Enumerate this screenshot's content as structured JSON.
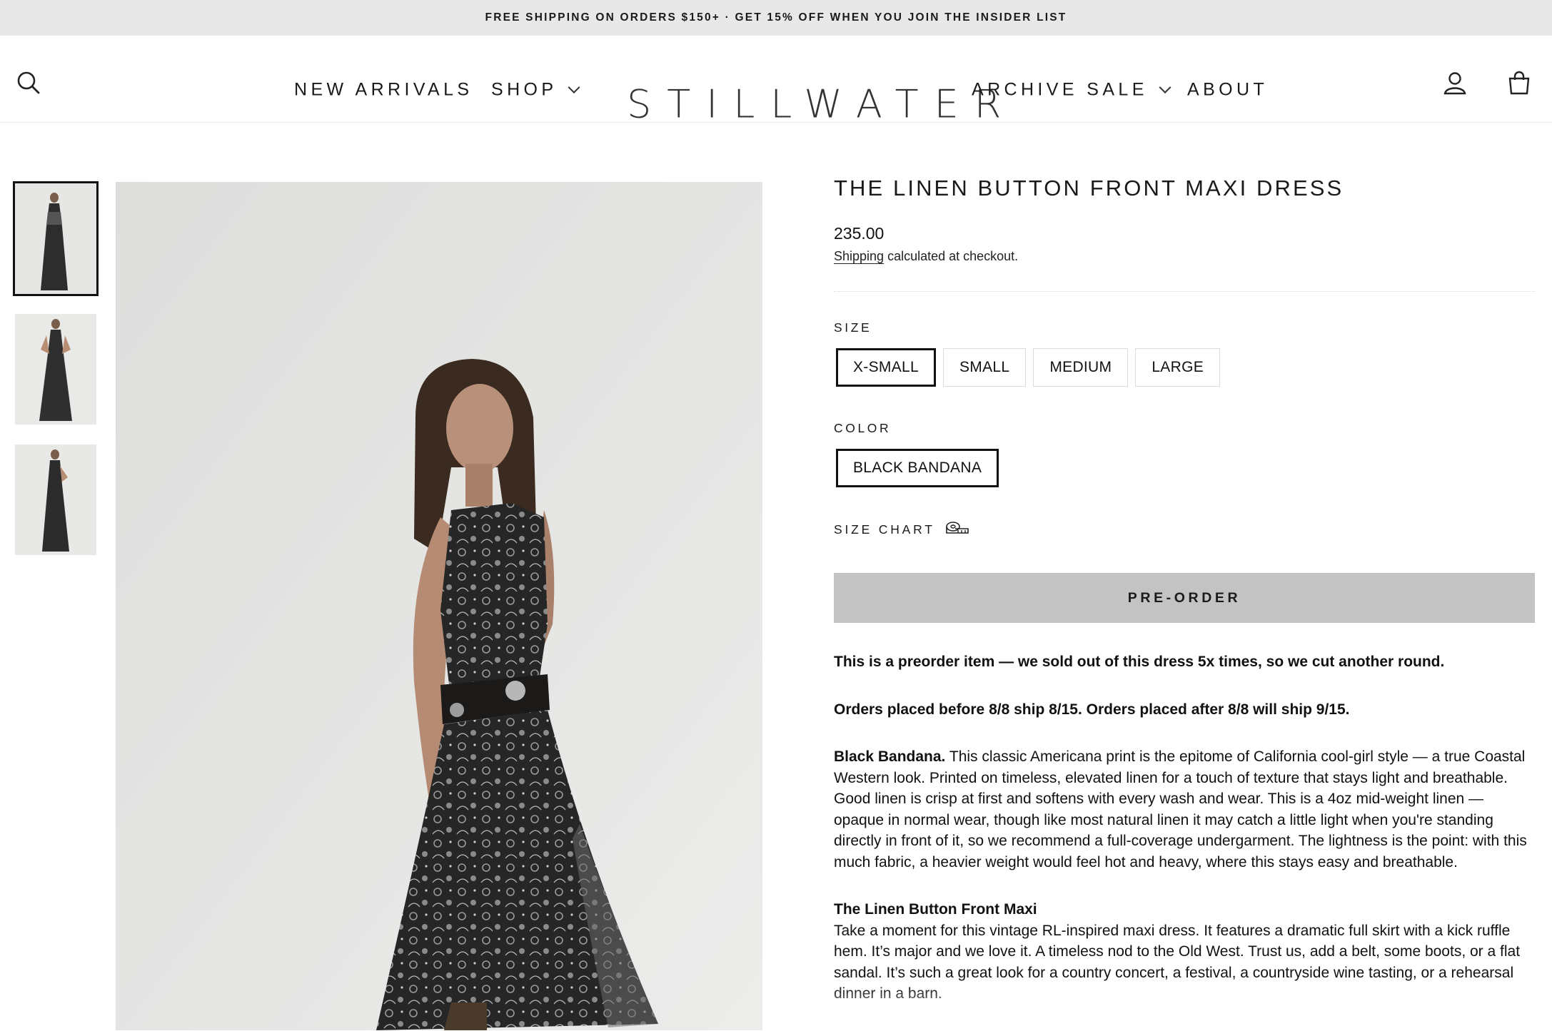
{
  "announcement": "FREE SHIPPING ON ORDERS $150+ · GET 15% OFF WHEN YOU JOIN THE INSIDER LIST",
  "header": {
    "logo": "STILLWATER",
    "nav": {
      "new_arrivals": "NEW ARRIVALS",
      "shop": "SHOP",
      "archive_sale": "ARCHIVE SALE",
      "about": "ABOUT"
    },
    "icons": [
      "search-icon",
      "account-icon",
      "cart-icon"
    ]
  },
  "gallery": {
    "thumbnail_count": 3,
    "active_thumbnail": 1
  },
  "product": {
    "title": "THE LINEN BUTTON FRONT MAXI DRESS",
    "price": "235.00",
    "shipping_link": "Shipping",
    "shipping_note": " calculated at checkout.",
    "size_label": "SIZE",
    "sizes": [
      "X-SMALL",
      "SMALL",
      "MEDIUM",
      "LARGE"
    ],
    "selected_size": "X-SMALL",
    "color_label": "COLOR",
    "colors": [
      "BLACK BANDANA"
    ],
    "selected_color": "BLACK BANDANA",
    "size_chart": "SIZE CHART",
    "cta": "PRE-ORDER"
  },
  "description": {
    "p1": "This is a preorder item — we sold out of this dress 5x times, so we cut another round.",
    "p2": "Orders placed before 8/8 ship 8/15. Orders placed after 8/8 will ship 9/15.",
    "p3_bold": "Black Bandana.",
    "p3_text": " This classic Americana print is the epitome of California cool-girl style — a true Coastal Western look. Printed on timeless, elevated linen for a touch of texture that stays light and breathable. Good linen is crisp at first and softens with every wash and wear. This is a 4oz mid-weight linen — opaque in normal wear, though like most natural linen it may catch a little light when you're standing directly in front of it, so we recommend a full-coverage undergarment. The lightness is the point: with this much fabric, a heavier weight would feel hot and heavy, where this stays easy and breathable.",
    "p4_heading": "The Linen Button Front Maxi",
    "p4_text": "Take a moment for this vintage RL-inspired maxi dress. It features a dramatic full skirt with a kick ruffle hem. It’s major and we love it. A timeless nod to the Old West. Trust us, add a belt, some boots, or a flat sandal. It’s such a great look for a country concert, a festival, a countryside wine tasting, or a rehearsal dinner in a barn."
  }
}
